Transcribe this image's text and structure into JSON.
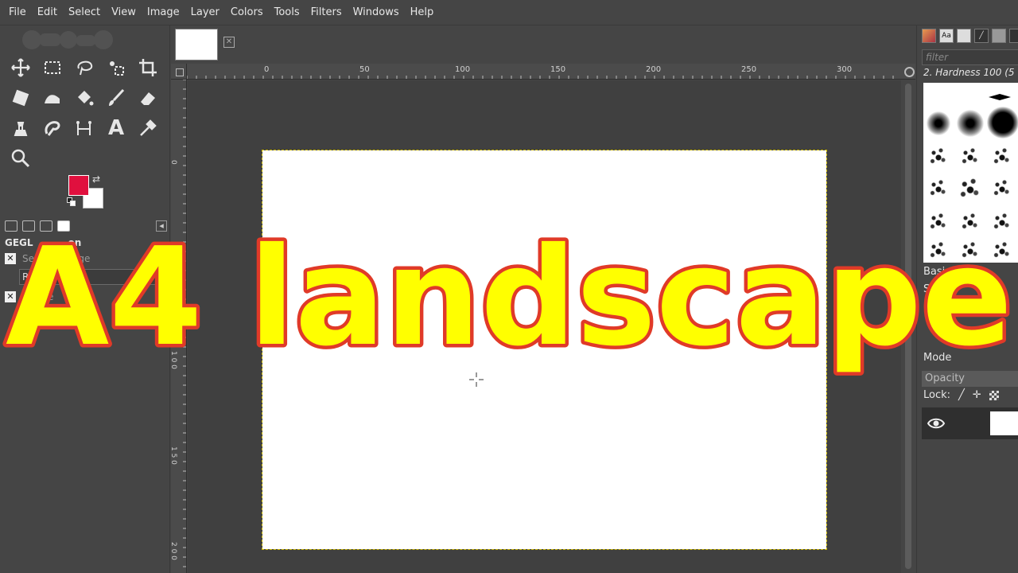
{
  "menu": [
    "File",
    "Edit",
    "Select",
    "View",
    "Image",
    "Layer",
    "Colors",
    "Tools",
    "Filters",
    "Windows",
    "Help"
  ],
  "colors": {
    "foreground": "#e0103e",
    "background": "#ffffff",
    "title_fill": "#ffff00",
    "title_stroke": "#e03a28"
  },
  "toolbox": {
    "tools": [
      {
        "icon": "move-icon"
      },
      {
        "icon": "rect-select-icon"
      },
      {
        "icon": "free-select-icon"
      },
      {
        "icon": "fuzzy-select-icon"
      },
      {
        "icon": "crop-icon"
      },
      {
        "icon": "unified-transform-icon"
      },
      {
        "icon": "warp-transform-icon"
      },
      {
        "icon": "bucket-fill-icon"
      },
      {
        "icon": "paintbrush-icon"
      },
      {
        "icon": "eraser-icon"
      },
      {
        "icon": "clone-icon"
      },
      {
        "icon": "smudge-icon"
      },
      {
        "icon": "paths-icon"
      },
      {
        "icon": "text-icon",
        "glyph": "A"
      },
      {
        "icon": "color-picker-icon"
      },
      {
        "icon": "zoom-icon"
      }
    ],
    "gegl_title": "GEGL",
    "gegl_title_tail": "on",
    "gegl_rows": [
      {
        "label": "Se",
        "tail": "age"
      },
      {
        "label": "",
        "tail": "e"
      }
    ],
    "gegl_input_value": "R"
  },
  "rulers": {
    "h_ticks": [
      "0",
      "50",
      "100",
      "150",
      "200",
      "250",
      "300"
    ],
    "v_ticks": [
      "0",
      "5 0",
      "1 0 0",
      "1 5 0",
      "2 0 0"
    ]
  },
  "right_dock": {
    "tab_labels": [
      "",
      "Aa",
      "",
      "",
      "",
      ""
    ],
    "filter_placeholder": "filter",
    "brush_name": "2. Hardness 100 (5",
    "preset_label": "Basi",
    "spacing_label": "Sp",
    "mode_label": "Mode",
    "opacity_label": "Opacity",
    "lock_label": "Lock:"
  },
  "overlay_title": "A4 landscape"
}
